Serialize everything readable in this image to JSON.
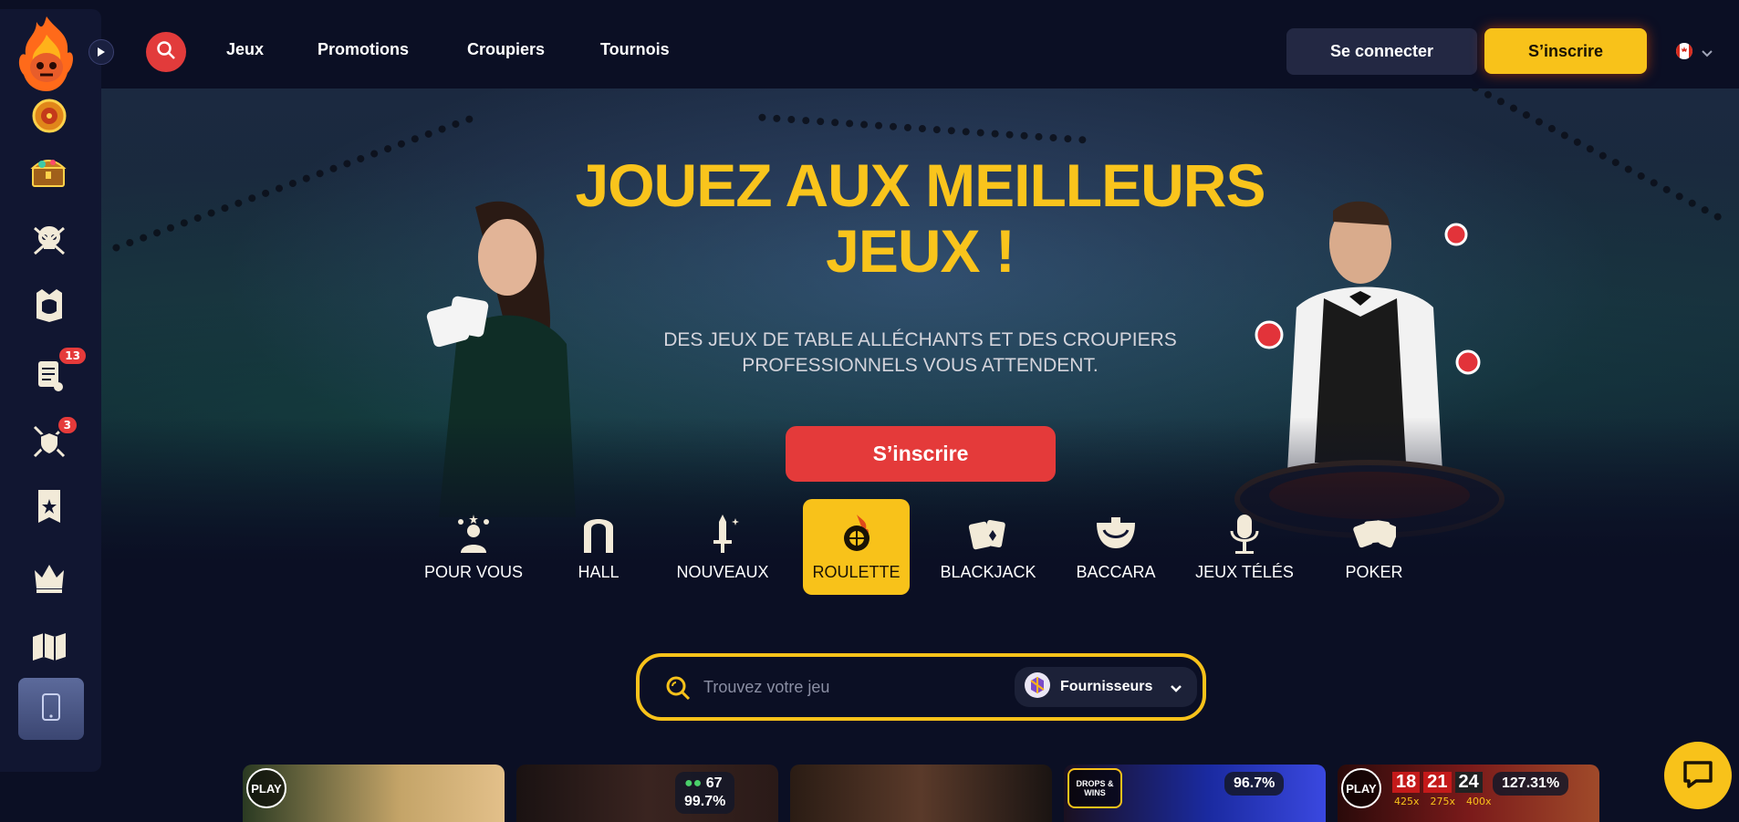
{
  "nav": {
    "items": [
      "Jeux",
      "Promotions",
      "Croupiers",
      "Tournois"
    ],
    "login_label": "Se connecter",
    "signup_label": "S’inscrire"
  },
  "sidebar": {
    "badges": {
      "missions": "13",
      "battles": "3"
    }
  },
  "hero": {
    "title_line1": "JOUEZ AUX MEILLEURS",
    "title_line2": "JEUX !",
    "subtitle_line1": "DES JEUX DE TABLE ALLÉCHANTS ET DES CROUPIERS",
    "subtitle_line2": "PROFESSIONNELS VOUS ATTENDENT.",
    "cta_label": "S’inscrire"
  },
  "categories": [
    {
      "label": "POUR VOUS",
      "icon": "user-star-icon"
    },
    {
      "label": "HALL",
      "icon": "arch-icon"
    },
    {
      "label": "NOUVEAUX",
      "icon": "sword-sparkle-icon"
    },
    {
      "label": "ROULETTE",
      "icon": "roulette-icon"
    },
    {
      "label": "BLACKJACK",
      "icon": "cards-icon"
    },
    {
      "label": "BACCARA",
      "icon": "baccarat-table-icon"
    },
    {
      "label": "JEUX TÉLÉS",
      "icon": "microphone-icon"
    },
    {
      "label": "POKER",
      "icon": "poker-cards-icon"
    }
  ],
  "search": {
    "placeholder": "Trouvez votre jeu",
    "providers_label": "Fournisseurs"
  },
  "cards": {
    "card2_players": "67",
    "card2_rtp": "99.7%",
    "card4_rtp": "96.7%",
    "card5_rtp": "127.31%",
    "card5_numbers": [
      "18",
      "21",
      "24"
    ],
    "card5_mults": [
      "425x",
      "275x",
      "400x"
    ],
    "play_badge": "PLAY",
    "drops_wins": "DROPS & WINS"
  },
  "colors": {
    "accent_yellow": "#f8c21a",
    "accent_red": "#e43a3a",
    "background": "#0b0f24"
  }
}
